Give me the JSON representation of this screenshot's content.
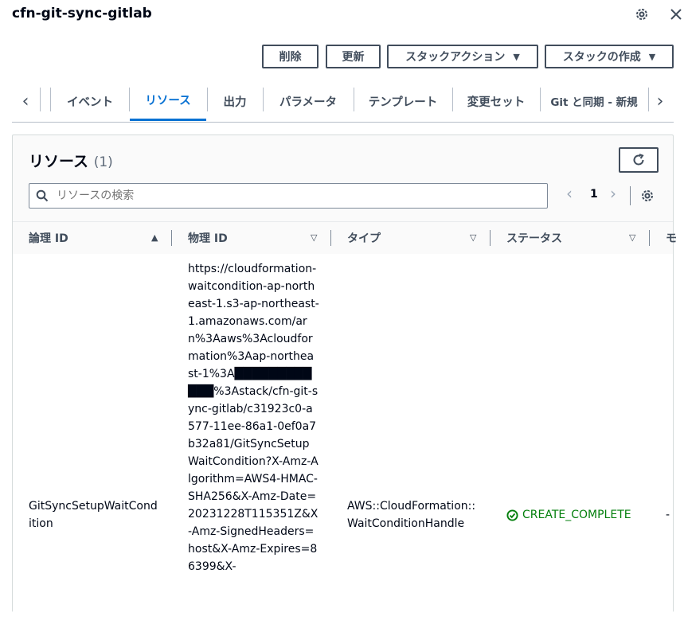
{
  "header": {
    "title": "cfn-git-sync-gitlab"
  },
  "actions": {
    "delete_label": "削除",
    "update_label": "更新",
    "stack_actions_label": "スタックアクション",
    "create_stack_label": "スタックの作成"
  },
  "tabs": [
    {
      "label": "イベント"
    },
    {
      "label": "リソース"
    },
    {
      "label": "出力"
    },
    {
      "label": "パラメータ"
    },
    {
      "label": "テンプレート"
    },
    {
      "label": "変更セット"
    },
    {
      "label": "Git と同期 - 新規"
    }
  ],
  "active_tab": "リソース",
  "resources": {
    "title": "リソース",
    "count": "(1)",
    "search_placeholder": "リソースの検索",
    "page": "1",
    "columns": [
      "論理 ID",
      "物理 ID",
      "タイプ",
      "ステータス",
      "モ"
    ],
    "rows": [
      {
        "logical_id": "GitSyncSetupWaitCondition",
        "physical_id": "https://cloudformation-waitcondition-ap-northeast-1.s3-ap-northeast-1.amazonaws.com/arn%3Aaws%3Acloudformation%3Aap-northeast-1%3A████████████%3Astack/cfn-git-sync-gitlab/c31923c0-a577-11ee-86a1-0ef0a7b32a81/GitSyncSetupWaitCondition?X-Amz-Algorithm=AWS4-HMAC-SHA256&X-Amz-Date=20231228T115351Z&X-Amz-SignedHeaders=host&X-Amz-Expires=86399&X-",
        "type": "AWS::CloudFormation::WaitConditionHandle",
        "status": "CREATE_COMPLETE",
        "module": "-"
      }
    ]
  },
  "colors": {
    "accent": "#0972d3",
    "success": "#037f0c",
    "text": "#000716",
    "secondary": "#414d5c"
  }
}
